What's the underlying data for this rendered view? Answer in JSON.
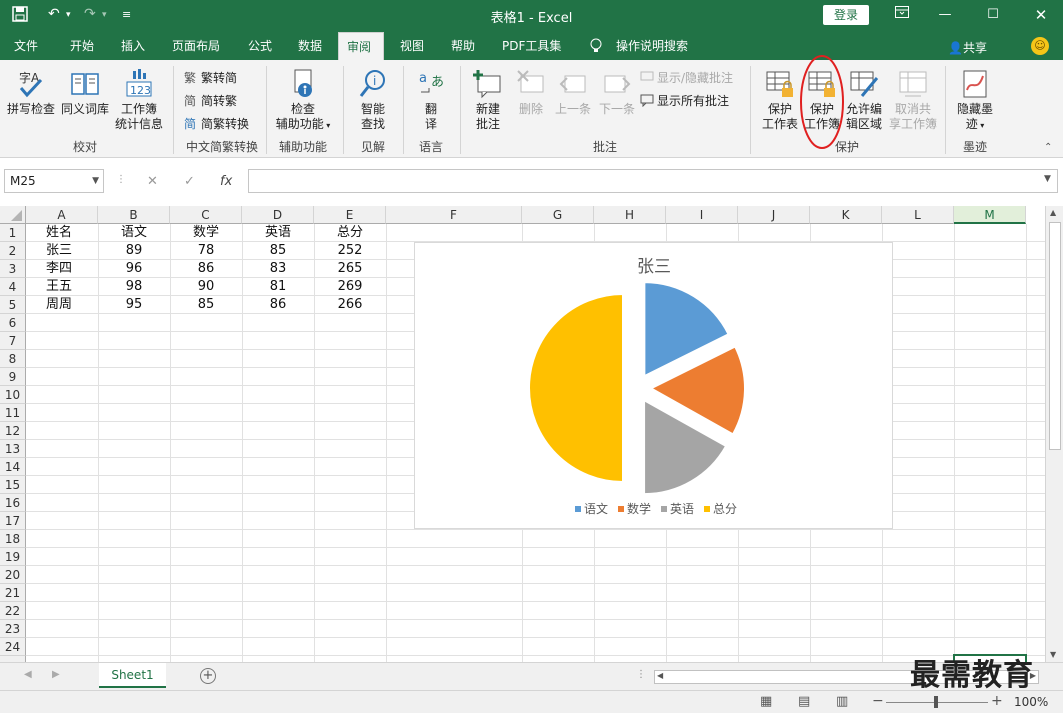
{
  "titlebar": {
    "title": "表格1 - Excel",
    "login_label": "登录",
    "quick_access": [
      "save-icon",
      "undo-icon",
      "redo-icon",
      "customize-icon"
    ]
  },
  "tabs": [
    "文件",
    "开始",
    "插入",
    "页面布局",
    "公式",
    "数据",
    "审阅",
    "视图",
    "帮助",
    "PDF工具集",
    "操作说明搜索"
  ],
  "active_tab": "审阅",
  "share_label": "共享",
  "ribbon": {
    "groups": {
      "proofing": "校对",
      "chinese": "中文简繁转换",
      "accessibility": "辅助功能",
      "insights": "见解",
      "language": "语言",
      "comments": "批注",
      "protect": "保护",
      "ink": "墨迹"
    },
    "buttons": {
      "spell_check": "拼写检查",
      "thesaurus": "同义词库",
      "workbook_stats_1": "工作簿",
      "workbook_stats_2": "统计信息",
      "trad_to_simp": "繁转简",
      "simp_to_trad": "简转繁",
      "convert": "简繁转换",
      "check_access_1": "检查",
      "check_access_2": "辅助功能",
      "smart_lookup_1": "智能",
      "smart_lookup_2": "查找",
      "translate_1": "翻",
      "translate_2": "译",
      "new_comment_1": "新建",
      "new_comment_2": "批注",
      "delete": "删除",
      "previous": "上一条",
      "next": "下一条",
      "show_hide_comment": "显示/隐藏批注",
      "show_all_comments": "显示所有批注",
      "protect_sheet_1": "保护",
      "protect_sheet_2": "工作表",
      "protect_workbook_1": "保护",
      "protect_workbook_2": "工作簿",
      "allow_edit_1": "允许编",
      "allow_edit_2": "辑区域",
      "unshare_1": "取消共",
      "unshare_2": "享工作簿",
      "hide_ink_1": "隐藏墨",
      "hide_ink_2": "迹"
    }
  },
  "formula_bar": {
    "name_box": "M25",
    "fx_label": "fx",
    "formula": ""
  },
  "grid": {
    "columns": [
      "A",
      "B",
      "C",
      "D",
      "E",
      "F",
      "G",
      "H",
      "I",
      "J",
      "K",
      "L",
      "M"
    ],
    "selected_column": "M",
    "rows": [
      "1",
      "2",
      "3",
      "4",
      "5",
      "6",
      "7",
      "8",
      "9",
      "10",
      "11",
      "12",
      "13",
      "14",
      "15",
      "16",
      "17",
      "18",
      "19",
      "20",
      "21",
      "22",
      "23",
      "24"
    ],
    "data": [
      [
        "姓名",
        "语文",
        "数学",
        "英语",
        "总分"
      ],
      [
        "张三",
        "89",
        "78",
        "85",
        "252"
      ],
      [
        "李四",
        "96",
        "86",
        "83",
        "265"
      ],
      [
        "王五",
        "98",
        "90",
        "81",
        "269"
      ],
      [
        "周周",
        "95",
        "85",
        "86",
        "266"
      ]
    ]
  },
  "chart_data": {
    "type": "pie",
    "title": "张三",
    "categories": [
      "语文",
      "数学",
      "英语",
      "总分"
    ],
    "values": [
      89,
      78,
      85,
      252
    ],
    "colors": [
      "#5b9bd5",
      "#ed7d31",
      "#a5a5a5",
      "#ffc000"
    ],
    "legend_position": "bottom"
  },
  "sheet_tabs": [
    "Sheet1"
  ],
  "status": {
    "zoom": "100%"
  },
  "watermark": "最需教育",
  "colors": {
    "accent": "#217346",
    "highlight_circle": "#e02020"
  }
}
